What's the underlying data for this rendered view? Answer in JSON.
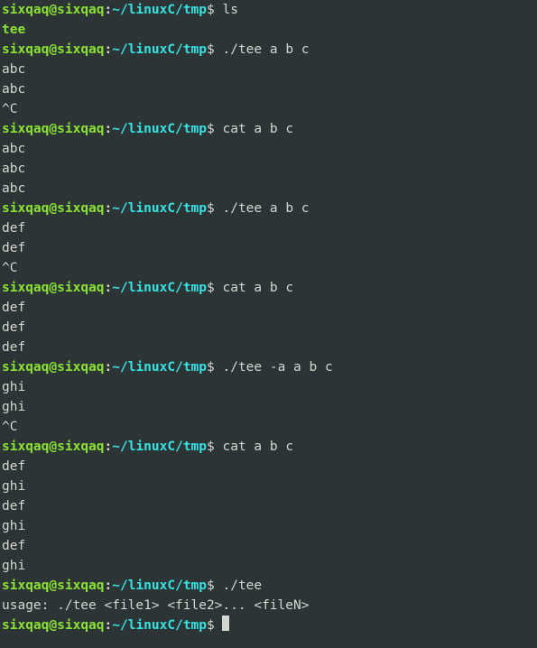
{
  "prompt": {
    "user": "sixqaq",
    "at": "@",
    "host": "sixqaq",
    "colon": ":",
    "path": "~/linuxC/tmp",
    "dollar": "$ "
  },
  "lines": [
    {
      "kind": "prompt",
      "cmd": "ls"
    },
    {
      "kind": "exec",
      "text": "tee"
    },
    {
      "kind": "prompt",
      "cmd": "./tee a b c"
    },
    {
      "kind": "out",
      "text": "abc"
    },
    {
      "kind": "out",
      "text": "abc"
    },
    {
      "kind": "out",
      "text": "^C"
    },
    {
      "kind": "prompt",
      "cmd": "cat a b c"
    },
    {
      "kind": "out",
      "text": "abc"
    },
    {
      "kind": "out",
      "text": "abc"
    },
    {
      "kind": "out",
      "text": "abc"
    },
    {
      "kind": "prompt",
      "cmd": "./tee a b c"
    },
    {
      "kind": "out",
      "text": "def"
    },
    {
      "kind": "out",
      "text": "def"
    },
    {
      "kind": "out",
      "text": "^C"
    },
    {
      "kind": "prompt",
      "cmd": "cat a b c"
    },
    {
      "kind": "out",
      "text": "def"
    },
    {
      "kind": "out",
      "text": "def"
    },
    {
      "kind": "out",
      "text": "def"
    },
    {
      "kind": "prompt",
      "cmd": "./tee -a a b c"
    },
    {
      "kind": "out",
      "text": "ghi"
    },
    {
      "kind": "out",
      "text": "ghi"
    },
    {
      "kind": "out",
      "text": "^C"
    },
    {
      "kind": "prompt",
      "cmd": "cat a b c"
    },
    {
      "kind": "out",
      "text": "def"
    },
    {
      "kind": "out",
      "text": "ghi"
    },
    {
      "kind": "out",
      "text": "def"
    },
    {
      "kind": "out",
      "text": "ghi"
    },
    {
      "kind": "out",
      "text": "def"
    },
    {
      "kind": "out",
      "text": "ghi"
    },
    {
      "kind": "prompt",
      "cmd": "./tee"
    },
    {
      "kind": "out",
      "text": "usage: ./tee <file1> <file2>... <fileN>"
    },
    {
      "kind": "prompt-cursor",
      "cmd": ""
    }
  ]
}
